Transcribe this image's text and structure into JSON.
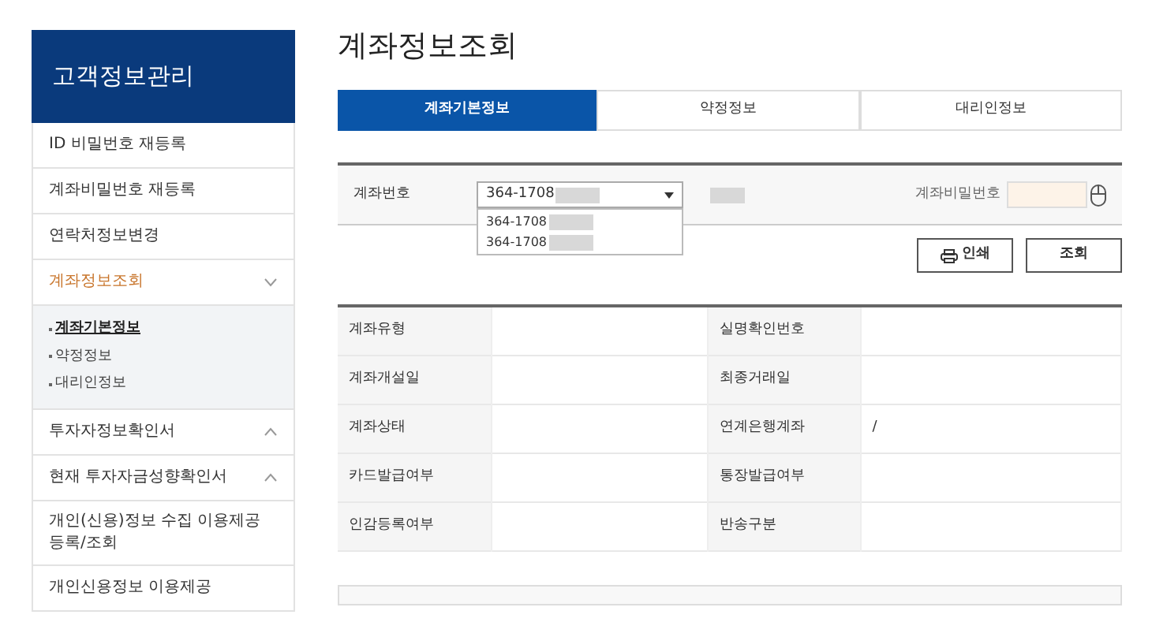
{
  "sidebar": {
    "title": "고객정보관리",
    "items": [
      {
        "label": "ID 비밀번호 재등록",
        "kind": "link",
        "selected": false
      },
      {
        "label": "계좌비밀번호 재등록",
        "kind": "link",
        "selected": false
      },
      {
        "label": "연락처정보변경",
        "kind": "link",
        "selected": false
      },
      {
        "label": "계좌정보조회",
        "kind": "group",
        "selected": true,
        "expanded": true,
        "children": [
          {
            "label": "계좌기본정보",
            "selected": true
          },
          {
            "label": "약정정보",
            "selected": false
          },
          {
            "label": "대리인정보",
            "selected": false
          }
        ]
      },
      {
        "label": "투자자정보확인서",
        "kind": "group",
        "selected": false,
        "expanded": false
      },
      {
        "label": "현재 투자자금성향확인서",
        "kind": "group",
        "selected": false,
        "expanded": false
      },
      {
        "label": "개인(신용)정보 수집 이용제공 등록/조회",
        "kind": "link",
        "selected": false
      },
      {
        "label": "개인신용정보 이용제공",
        "kind": "link",
        "selected": false
      }
    ]
  },
  "page_title": "계좌정보조회",
  "tabs": [
    {
      "label": "계좌기본정보",
      "selected": true
    },
    {
      "label": "약정정보",
      "selected": false
    },
    {
      "label": "대리인정보",
      "selected": false
    }
  ],
  "account_form": {
    "label": "계좌번호",
    "value": "364-1708",
    "options": [
      "364-1708",
      "364-1708"
    ],
    "open": true,
    "password_label": "계좌비밀번호"
  },
  "buttons": [
    {
      "label": "인쇄",
      "kind": "print"
    },
    {
      "label": "조회",
      "kind": "plain"
    }
  ],
  "table": {
    "rows": [
      [
        "계좌유형",
        "",
        "실명확인번호",
        ""
      ],
      [
        "계좌개설일",
        "",
        "최종거래일",
        ""
      ],
      [
        "계좌상태",
        "",
        "연계은행계좌",
        "/"
      ],
      [
        "카드발급여부",
        "",
        "통장발급여부",
        ""
      ],
      [
        "인감등록여부",
        "",
        "반송구분",
        ""
      ]
    ]
  }
}
